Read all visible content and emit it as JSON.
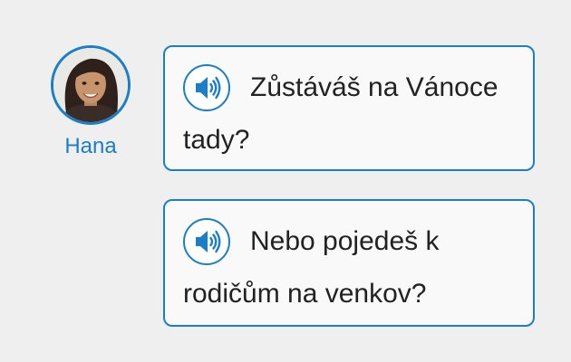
{
  "speaker": {
    "name": "Hana",
    "avatar_icon": "woman-portrait-avatar"
  },
  "accent_color": "#1a7ec8",
  "messages": [
    {
      "text": "Zůstáváš na Vánoce tady?",
      "audio_icon": "speaker-sound-icon"
    },
    {
      "text": "Nebo pojedeš k rodičům na venkov?",
      "audio_icon": "speaker-sound-icon"
    }
  ]
}
